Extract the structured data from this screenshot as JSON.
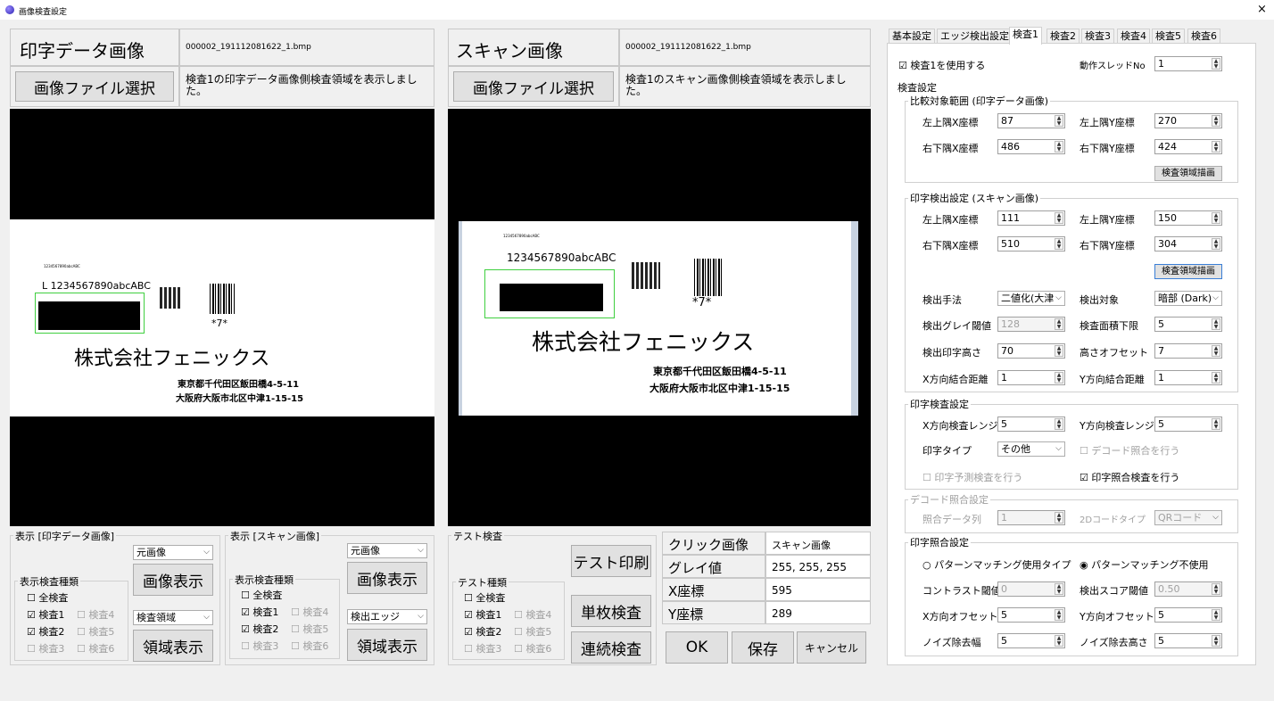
{
  "window": {
    "title": "画像検査設定",
    "close": "×"
  },
  "left": {
    "title": "印字データ画像",
    "filename": "000002_191112081622_1.bmp",
    "select_button": "画像ファイル選択",
    "note": "検査1の印字データ画像側検査領域を表示しました。",
    "label": {
      "tiny": "1234567890abcABC",
      "line1": "L 1234567890abcABC",
      "company": "株式会社フェニックス",
      "addr1": "東京都千代田区飯田橋4-5-11",
      "addr2": "大阪府大阪市北区中津1-15-15",
      "barcode_text": "*7*"
    }
  },
  "scan": {
    "title": "スキャン画像",
    "filename": "000002_191112081622_1.bmp",
    "select_button": "画像ファイル選択",
    "note": "検査1のスキャン画像側検査領域を表示しました。",
    "label": {
      "tiny": "1234567890abcABC",
      "line1": "1234567890abcABC",
      "company": "株式会社フェニックス",
      "addr1": "東京都千代田区飯田橋4-5-11",
      "addr2": "大阪府大阪市北区中津1-15-15",
      "barcode_text": "*7*"
    }
  },
  "disp_print": {
    "group": "表示 [印字データ画像]",
    "type_combo": "元画像",
    "show_button": "画像表示",
    "kinds_group": "表示検査種類",
    "all": "全検査",
    "c1": "検査1",
    "c2": "検査2",
    "c3": "検査3",
    "c4": "検査4",
    "c5": "検査5",
    "c6": "検査6",
    "region_combo": "検査領域",
    "region_button": "領域表示"
  },
  "disp_scan": {
    "group": "表示 [スキャン画像]",
    "type_combo": "元画像",
    "show_button": "画像表示",
    "kinds_group": "表示検査種類",
    "all": "全検査",
    "c1": "検査1",
    "c2": "検査2",
    "c3": "検査3",
    "c4": "検査4",
    "c5": "検査5",
    "c6": "検査6",
    "region_combo": "検出エッジ",
    "region_button": "領域表示"
  },
  "test": {
    "group": "テスト検査",
    "kinds_group": "テスト種類",
    "all": "全検査",
    "c1": "検査1",
    "c2": "検査2",
    "c3": "検査3",
    "c4": "検査4",
    "c5": "検査5",
    "c6": "検査6",
    "print_button": "テスト印刷",
    "single_button": "単枚検査",
    "continuous_button": "連続検査"
  },
  "info": {
    "rows": [
      {
        "k": "クリック画像",
        "v": "スキャン画像"
      },
      {
        "k": "グレイ値",
        "v": "255, 255, 255"
      },
      {
        "k": "X座標",
        "v": "595"
      },
      {
        "k": "Y座標",
        "v": "289"
      }
    ]
  },
  "buttons": {
    "ok": "OK",
    "save": "保存",
    "cancel": "キャンセル"
  },
  "tabs": [
    "基本設定",
    "エッジ検出設定",
    "検査1",
    "検査2",
    "検査3",
    "検査4",
    "検査5",
    "検査6"
  ],
  "settings": {
    "use_check": "検査1を使用する",
    "thread_label": "動作スレッドNo",
    "thread_value": "1",
    "inspect_group": "検査設定",
    "compare_group": "比較対象範囲 (印字データ画像)",
    "lx": "左上隅X座標",
    "lx_v": "87",
    "ly": "左上隅Y座標",
    "ly_v": "270",
    "rx": "右下隅X座標",
    "rx_v": "486",
    "ry": "右下隅Y座標",
    "ry_v": "424",
    "draw1": "検査領域描画",
    "detect_group": "印字検出設定 (スキャン画像)",
    "dlx": "左上隅X座標",
    "dlx_v": "111",
    "dly": "左上隅Y座標",
    "dly_v": "150",
    "drx": "右下隅X座標",
    "drx_v": "510",
    "dry": "右下隅Y座標",
    "dry_v": "304",
    "draw2": "検査領域描画",
    "method": "検出手法",
    "method_v": "二値化(大津",
    "target": "検出対象",
    "target_v": "暗部 (Dark)",
    "gray": "検出グレイ閾値",
    "gray_v": "128",
    "area": "検査面積下限",
    "area_v": "5",
    "height": "検出印字高さ",
    "height_v": "70",
    "hoff": "高さオフセット",
    "hoff_v": "7",
    "xjoin": "X方向結合距離",
    "xjoin_v": "1",
    "yjoin": "Y方向結合距離",
    "yjoin_v": "1",
    "print_group": "印字検査設定",
    "xrange": "X方向検査レンジ",
    "xrange_v": "5",
    "yrange": "Y方向検査レンジ",
    "yrange_v": "5",
    "ptype": "印字タイプ",
    "ptype_v": "その他",
    "decode_chk": "デコード照合を行う",
    "predict_chk": "印字予測検査を行う",
    "match_chk": "印字照合検査を行う",
    "decode_group": "デコード照合設定",
    "col": "照合データ列",
    "col_v": "1",
    "code2d": "2Dコードタイプ",
    "code2d_v": "QRコード",
    "match_group": "印字照合設定",
    "pm_use": "パターンマッチング使用タイプ",
    "pm_nouse": "パターンマッチング不使用",
    "contrast": "コントラスト閾値",
    "contrast_v": "0",
    "score": "検出スコア閾値",
    "score_v": "0.50",
    "xoff": "X方向オフセット",
    "xoff_v": "5",
    "yoff": "Y方向オフセット",
    "yoff_v": "5",
    "nw": "ノイズ除去幅",
    "nw_v": "5",
    "nh": "ノイズ除去高さ",
    "nh_v": "5"
  }
}
